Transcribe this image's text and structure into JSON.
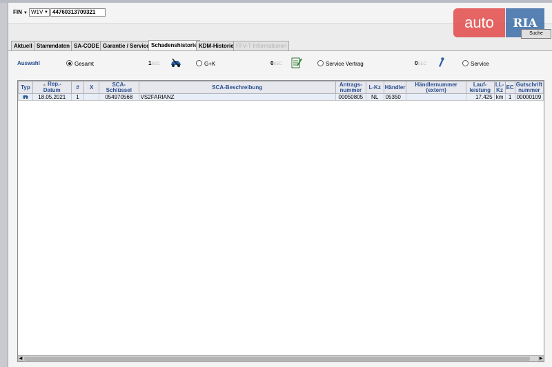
{
  "header": {
    "fin_label": "FIN",
    "fin_arrow": "▼",
    "prefix_value": "W1V",
    "vin_value": "44760313709321",
    "search_button": "Suche"
  },
  "logo": {
    "part1": "auto",
    "part2": "RIA"
  },
  "tabs": [
    {
      "label": "Aktuell",
      "state": "normal"
    },
    {
      "label": "Stammdaten",
      "state": "normal"
    },
    {
      "label": "SA-CODE",
      "state": "normal"
    },
    {
      "label": "Garantie / Service",
      "state": "normal"
    },
    {
      "label": "Schadenshistorie",
      "state": "active"
    },
    {
      "label": "KDM-Historie",
      "state": "normal"
    },
    {
      "label": "FFV-T Informationen",
      "state": "disabled"
    }
  ],
  "filter": {
    "label": "Auswahl",
    "options": [
      {
        "label": "Gesamt",
        "count": "1",
        "selected": true,
        "icon": "car-damage-icon"
      },
      {
        "label": "G+K",
        "count": "0",
        "selected": false,
        "icon": "document-edit-icon"
      },
      {
        "label": "Service Vertrag",
        "count": "0",
        "selected": false,
        "icon": "wrench-icon"
      },
      {
        "label": "Service",
        "count": "",
        "selected": false,
        "icon": ""
      }
    ],
    "count_suffix": "SEC"
  },
  "table": {
    "columns": [
      "Typ",
      "Rep.-\nDatum",
      "#",
      "X",
      "SCA-\nSchlüssel",
      "SCA-Beschreibung",
      "Antrags-\nnummer",
      "L-Kz",
      "Händler",
      "Händlernummer\n(extern)",
      "Lauf-\nleistung",
      "LL-\nKz",
      "EC",
      "Gutschrift\nnummer"
    ],
    "rows": [
      {
        "typ_icon": "car-icon",
        "datum": "18.05.2021",
        "nr": "1",
        "x": "",
        "schluessel": "054970568",
        "beschreibung": "VS2FARIANZ",
        "antrag": "00050805",
        "lkz": "NL",
        "haendler": "05350",
        "haendler_extern": "",
        "laufleistung": "17.425",
        "llkz": "km",
        "ec": "1",
        "gutschrift": "00000109"
      }
    ]
  },
  "colors": {
    "accent_blue": "#2a4d8f",
    "logo_red": "#e34b4b",
    "logo_blue": "#3c6ea8"
  }
}
